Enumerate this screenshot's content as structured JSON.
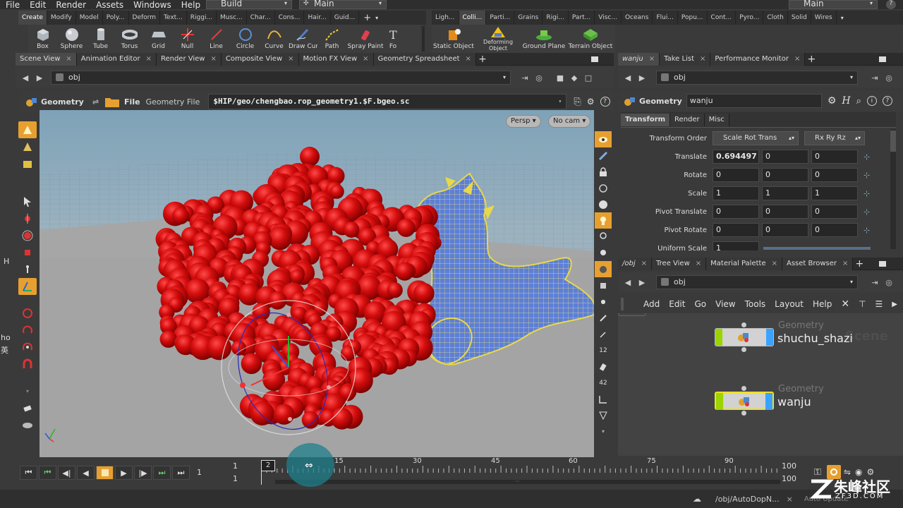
{
  "menubar": {
    "items": [
      "File",
      "Edit",
      "Render",
      "Assets",
      "Windows",
      "Help"
    ],
    "desktop_left": "Build",
    "desktop_center": "Main",
    "desktop_right": "Main"
  },
  "shelf_left": {
    "tabs": [
      "Create",
      "Modify",
      "Model",
      "Poly...",
      "Deform",
      "Text...",
      "Riggi...",
      "Musc...",
      "Char...",
      "Cons...",
      "Hair...",
      "Guid..."
    ],
    "tools": [
      "Box",
      "Sphere",
      "Tube",
      "Torus",
      "Grid",
      "Null",
      "Line",
      "Circle",
      "Curve",
      "Draw Curve",
      "Path",
      "Spray Paint",
      "Fo"
    ]
  },
  "shelf_right": {
    "tabs": [
      "Ligh...",
      "Colli...",
      "Parti...",
      "Grains",
      "Rigi...",
      "Part...",
      "Visc...",
      "Oceans",
      "Flui...",
      "Popu...",
      "Cont...",
      "Pyro...",
      "Cloth",
      "Solid",
      "Wires"
    ],
    "tools": [
      "Static Object",
      "Deforming Object",
      "Ground Plane",
      "Terrain Object"
    ]
  },
  "left_pane": {
    "tabs": [
      "Scene View",
      "Animation Editor",
      "Render View",
      "Composite View",
      "Motion FX View",
      "Geometry Spreadsheet"
    ],
    "path": "obj",
    "op_type": "Geometry",
    "file_label": "File",
    "file_sublabel": "Geometry File",
    "file_path": "$HIP/geo/chengbao.rop_geometry1.$F.bgeo.sc",
    "persp_label": "Persp",
    "cam_label": "No cam"
  },
  "params_pane": {
    "tabs": [
      "wanju",
      "Take List",
      "Performance Monitor"
    ],
    "path": "obj",
    "op_type": "Geometry",
    "node_name": "wanju",
    "section_tabs": [
      "Transform",
      "Render",
      "Misc"
    ],
    "rows": [
      {
        "label": "Transform Order",
        "values": [
          "Scale Rot Trans",
          "Rx Ry Rz"
        ]
      },
      {
        "label": "Translate",
        "values": [
          "0.694497",
          "0",
          "0"
        ]
      },
      {
        "label": "Rotate",
        "values": [
          "0",
          "0",
          "0"
        ]
      },
      {
        "label": "Scale",
        "values": [
          "1",
          "1",
          "1"
        ]
      },
      {
        "label": "Pivot Translate",
        "values": [
          "0",
          "0",
          "0"
        ]
      },
      {
        "label": "Pivot Rotate",
        "values": [
          "0",
          "0",
          "0"
        ]
      },
      {
        "label": "Uniform Scale",
        "values": [
          "1"
        ]
      }
    ]
  },
  "network_pane": {
    "tabs": [
      "/obj",
      "Tree View",
      "Material Palette",
      "Asset Browser"
    ],
    "path": "obj",
    "menu": [
      "Add",
      "Edit",
      "Go",
      "View",
      "Tools",
      "Layout",
      "Help"
    ],
    "watermark": "Scene",
    "nodes": [
      {
        "type": "Geometry",
        "name": "shuchu_shazi"
      },
      {
        "type": "Geometry",
        "name": "wanju"
      }
    ]
  },
  "timeline": {
    "current_frame": "1",
    "start_frame": "1",
    "start_frame2": "1",
    "playhead_frame": "2",
    "end_frame": "100",
    "end_frame2": "100",
    "ticks": [
      "15",
      "30",
      "45",
      "60",
      "75",
      "90"
    ]
  },
  "status": {
    "path": "/obj/AutoDopN...",
    "update": "Auto Update"
  },
  "edge_labels": [
    "H",
    "ho",
    "英"
  ],
  "watermark": {
    "brand": "朱峰社区",
    "site": "ZF3D.COM"
  },
  "colors": {
    "spheres": "#c80c0c",
    "wire": "#e8d84a",
    "mesh_blue": "#4a6fd8",
    "node_green": "#9bd400",
    "node_blue": "#3aa3ff",
    "accent_orange": "#e7a030"
  }
}
